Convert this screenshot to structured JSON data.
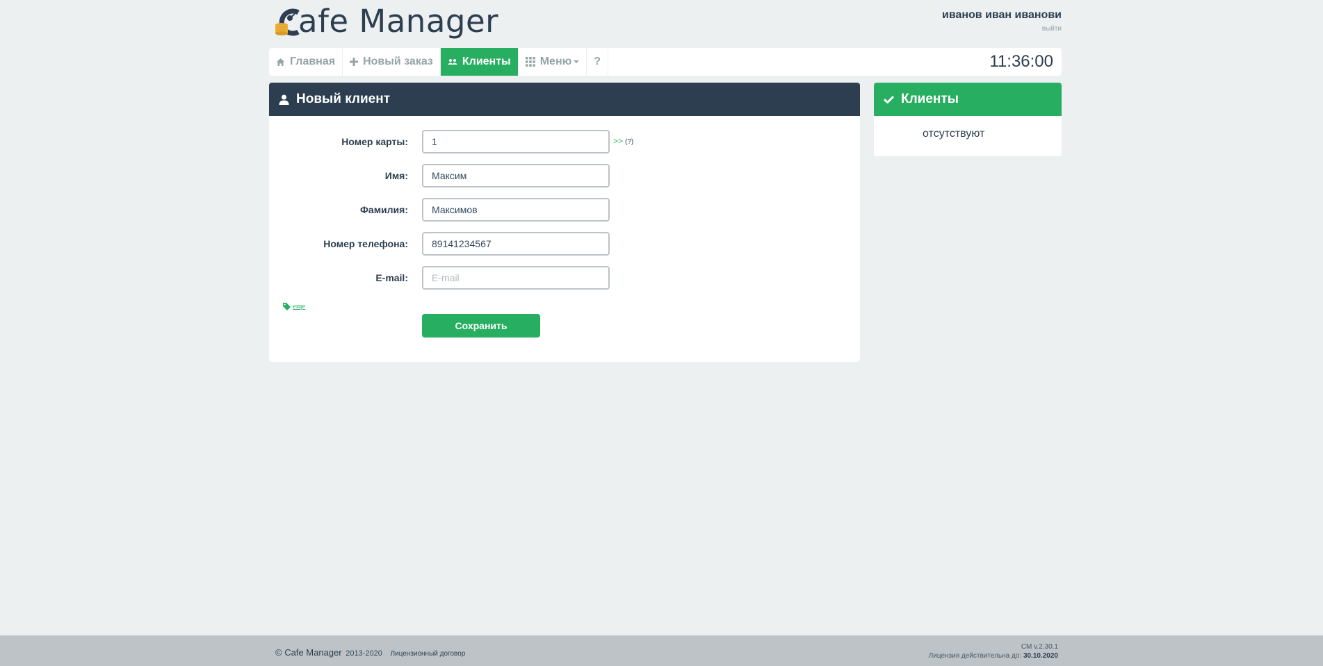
{
  "app": {
    "logo_text": "afe Manager"
  },
  "user": {
    "name": "иванов иван иванови",
    "logout": "выйти"
  },
  "nav": {
    "items": [
      {
        "label": "Главная",
        "icon": "home-icon"
      },
      {
        "label": "Новый заказ",
        "icon": "plus-icon"
      },
      {
        "label": "Клиенты",
        "icon": "users-icon",
        "active": true
      },
      {
        "label": "Меню",
        "icon": "grid-icon"
      },
      {
        "label": "?",
        "icon": ""
      }
    ],
    "clock": "11:36:00"
  },
  "form": {
    "title": "Новый клиент",
    "card_label": "Номер карты:",
    "card_value": "1",
    "card_arrows": ">>",
    "card_help": "(?)",
    "name_label": "Имя:",
    "name_value": "Максим",
    "surname_label": "Фамилия:",
    "surname_value": "Максимов",
    "phone_label": "Номер телефона:",
    "phone_value": "89141234567",
    "email_label": "E-mail:",
    "email_placeholder": "E-mail",
    "more": "еще",
    "save": "Сохранить"
  },
  "side": {
    "title": "Клиенты",
    "empty": "отсутствуют"
  },
  "footer": {
    "copyright": "© Cafe Manager",
    "years": "2013-2020",
    "license_link": "Лицензионный договор",
    "version": "CM v.2.30.1",
    "license_label": "Лицензия действительна до:",
    "license_date": "30.10.2020"
  },
  "colors": {
    "accent": "#27ae60",
    "dark": "#2c3e50",
    "background": "#ecf0f1",
    "footer": "#bdc3c7"
  }
}
